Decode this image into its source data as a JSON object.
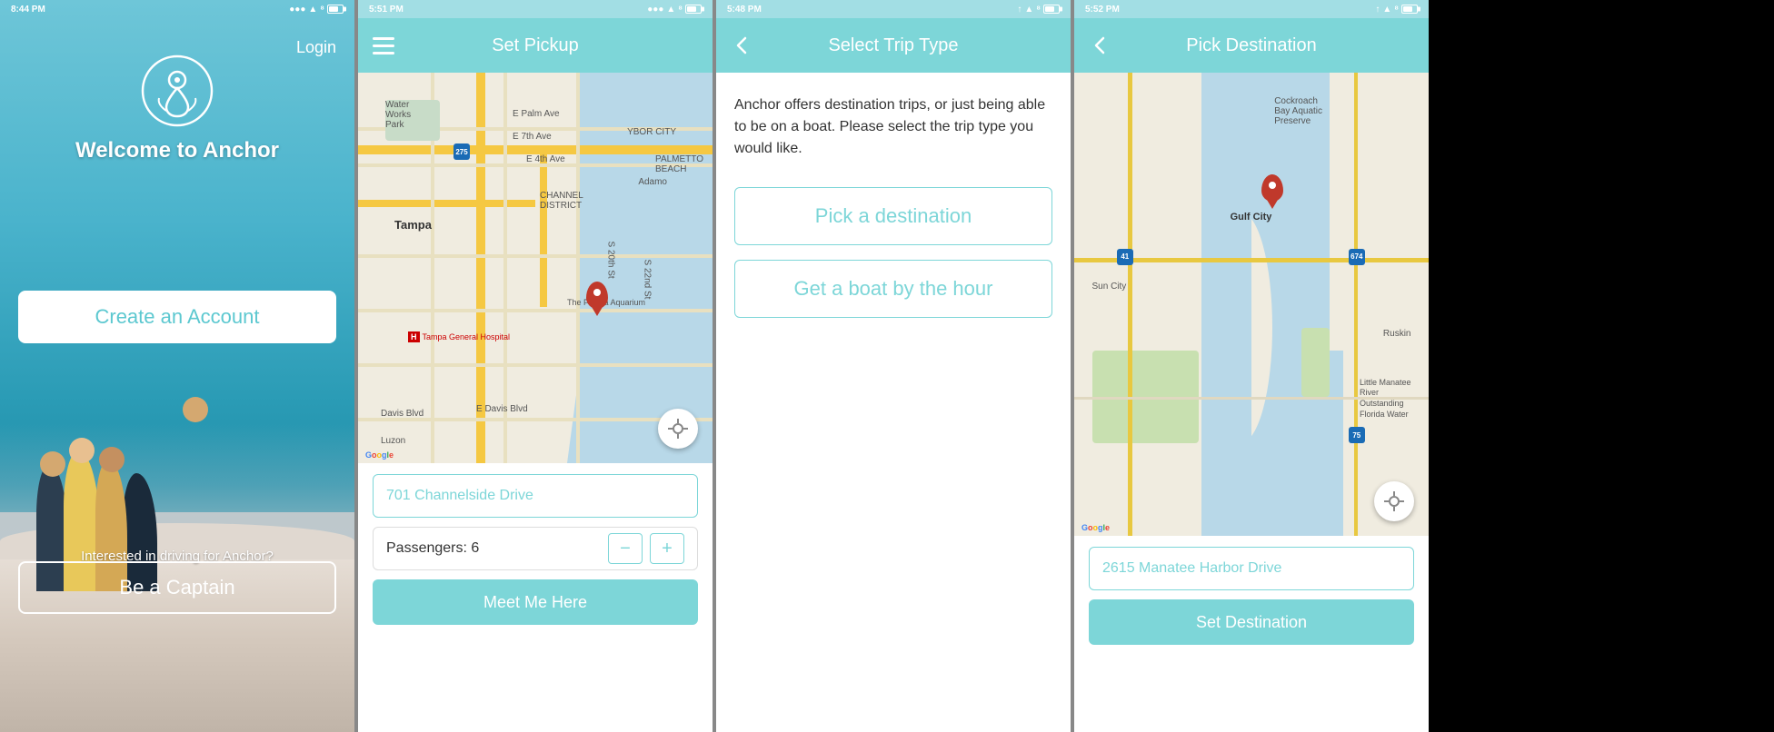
{
  "screen1": {
    "status_time": "8:44 PM",
    "login_label": "Login",
    "welcome_label": "Welcome to Anchor",
    "create_account_label": "Create an Account",
    "interested_label": "Interested in driving for Anchor?",
    "captain_label": "Be a Captain"
  },
  "screen2": {
    "status_time": "5:51 PM",
    "header_title": "Set Pickup",
    "address_value": "701 Channelside Drive",
    "address_placeholder": "701 Channelside Drive",
    "passengers_label": "Passengers: 6",
    "passengers_count": 6,
    "decrement_label": "−",
    "increment_label": "+",
    "meet_btn_label": "Meet Me Here",
    "google_label": "Google"
  },
  "screen3": {
    "status_time": "5:48 PM",
    "header_title": "Select Trip Type",
    "description": "Anchor offers destination trips, or just being able to be on a boat. Please select the trip type you would like.",
    "pick_destination_label": "Pick a destination",
    "get_boat_label": "Get a boat by the hour"
  },
  "screen4": {
    "status_time": "5:52 PM",
    "header_title": "Pick Destination",
    "address_value": "2615 Manatee Harbor Drive",
    "address_placeholder": "2615 Manatee Harbor Drive",
    "set_destination_label": "Set Destination",
    "google_label": "Google"
  },
  "icons": {
    "hamburger": "≡",
    "back_arrow": "‹",
    "location_crosshair": "⊕",
    "wifi": "WiFi",
    "bluetooth": "⁸",
    "battery": "▮"
  }
}
